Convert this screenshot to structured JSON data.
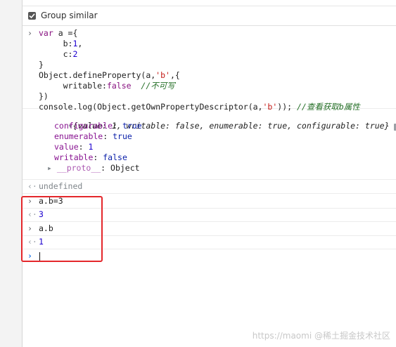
{
  "settings": {
    "group_similar_label": "Group similar"
  },
  "input1": {
    "lines": [
      "var a ={",
      "     b:1,",
      "     c:2",
      "}",
      "Object.defineProperty(a,'b',{",
      "     writable:false  //不可写",
      "})",
      "console.log(Object.getOwnPropertyDescriptor(a,'b')); //查看获取b属性"
    ]
  },
  "log": {
    "summary": "{value: 1, writable: false, enumerable: true, configurable: true}",
    "props": [
      {
        "key": "configurable",
        "value": "true"
      },
      {
        "key": "enumerable",
        "value": "true"
      },
      {
        "key": "value",
        "value": "1"
      },
      {
        "key": "writable",
        "value": "false"
      }
    ],
    "proto_key": "__proto__",
    "proto_value": "Object",
    "info_icon_label": "i"
  },
  "result1": "undefined",
  "input2": "a.b=3",
  "result2": "3",
  "input3": "a.b",
  "result3": "1",
  "watermark": "https://maomi  @稀土掘金技术社区",
  "colors": {
    "highlight_box": "#e4272b"
  }
}
